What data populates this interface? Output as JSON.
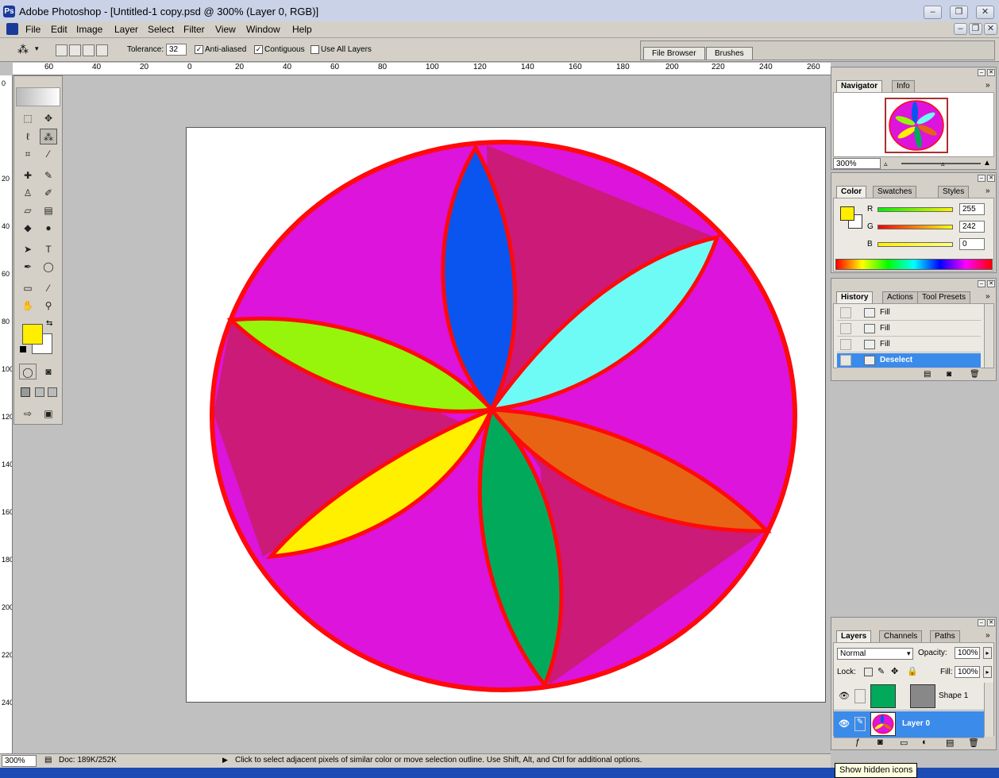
{
  "window": {
    "title": "Adobe Photoshop - [Untitled-1 copy.psd @ 300% (Layer 0, RGB)]",
    "minimize": "–",
    "restore": "❐",
    "close": "✕"
  },
  "menu": {
    "items": [
      "File",
      "Edit",
      "Image",
      "Layer",
      "Select",
      "Filter",
      "View",
      "Window",
      "Help"
    ],
    "doc_minimize": "–",
    "doc_restore": "❐",
    "doc_close": "✕"
  },
  "options": {
    "tolerance_label": "Tolerance:",
    "tolerance_value": "32",
    "anti_aliased_label": "Anti-aliased",
    "anti_aliased_checked": true,
    "contiguous_label": "Contiguous",
    "contiguous_checked": true,
    "use_all_layers_label": "Use All Layers",
    "use_all_layers_checked": false
  },
  "palette_well": {
    "tabs": [
      "File Browser",
      "Brushes"
    ]
  },
  "rulers": {
    "horizontal": [
      "60",
      "40",
      "20",
      "0",
      "20",
      "40",
      "60",
      "80",
      "100",
      "120",
      "140",
      "160",
      "180",
      "200",
      "220",
      "240",
      "260"
    ],
    "vertical": [
      "0",
      "20",
      "40",
      "60",
      "80",
      "100",
      "120",
      "140",
      "160",
      "180",
      "200",
      "220",
      "240"
    ]
  },
  "navigator": {
    "tabs": [
      "Navigator",
      "Info"
    ],
    "zoom": "300%"
  },
  "color": {
    "tabs": [
      "Color",
      "Swatches",
      "Styles"
    ],
    "foreground": "#ffee00",
    "channels": [
      {
        "label": "R",
        "value": "255"
      },
      {
        "label": "G",
        "value": "242"
      },
      {
        "label": "B",
        "value": "0"
      }
    ]
  },
  "history": {
    "tabs": [
      "History",
      "Actions",
      "Tool Presets"
    ],
    "items": [
      {
        "label": "Fill",
        "selected": false
      },
      {
        "label": "Fill",
        "selected": false
      },
      {
        "label": "Fill",
        "selected": false
      },
      {
        "label": "Deselect",
        "selected": true
      }
    ]
  },
  "layers": {
    "tabs": [
      "Layers",
      "Channels",
      "Paths"
    ],
    "blend_mode": "Normal",
    "opacity_label": "Opacity:",
    "opacity": "100%",
    "lock_label": "Lock:",
    "fill_label": "Fill:",
    "fill": "100%",
    "items": [
      {
        "name": "Shape 1",
        "selected": false
      },
      {
        "name": "Layer 0",
        "selected": true
      }
    ]
  },
  "status": {
    "zoom": "300%",
    "doc": "Doc: 189K/252K",
    "hint": "Click to select adjacent pixels of similar color or move selection outline.  Use Shift, Alt, and Ctrl for additional options."
  },
  "tooltip": "Show hidden icons",
  "colors": {
    "circle_fill": "#dc14dc",
    "sector_dark": "#cc1a78",
    "outline": "#ff0a0a",
    "petal_blue": "#0a55f0",
    "petal_cyan": "#6efaf5",
    "petal_lime": "#96f50a",
    "petal_yellow": "#fff000",
    "petal_green": "#00aa5a",
    "petal_orange": "#e66414",
    "selection_blue": "#3b8bea"
  }
}
